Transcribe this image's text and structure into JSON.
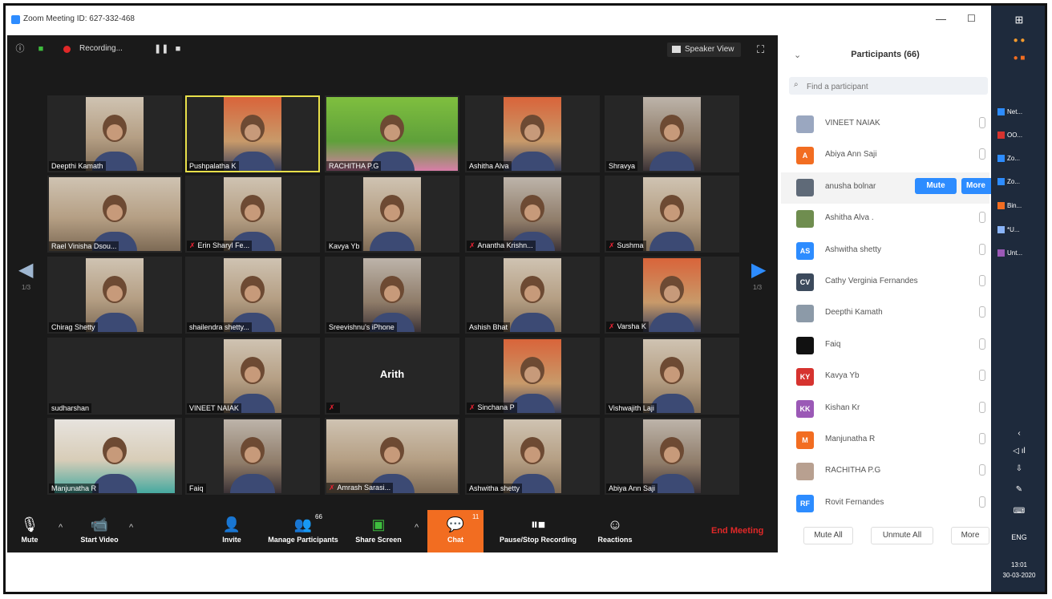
{
  "window": {
    "title": "Zoom Meeting ID: 627-332-468",
    "minimize": "—",
    "maximize": "☐"
  },
  "topbar": {
    "recording": "Recording...",
    "speaker_view": "Speaker View"
  },
  "gallery": {
    "page_left": "1/3",
    "page_right": "1/3",
    "rows": [
      [
        {
          "name": "Deepthi Kamath",
          "muted": false
        },
        {
          "name": "Pushpalatha K",
          "muted": false,
          "active": true
        },
        {
          "name": "RACHITHA P.G",
          "muted": false
        },
        {
          "name": "Ashitha Alva",
          "muted": false
        },
        {
          "name": "Shravya",
          "muted": false
        }
      ],
      [
        {
          "name": "Rael Vinisha Dsou...",
          "muted": false
        },
        {
          "name": "Erin Sharyl Fe...",
          "muted": true
        },
        {
          "name": "Kavya Yb",
          "muted": false
        },
        {
          "name": "Anantha Krishn...",
          "muted": true
        },
        {
          "name": "Sushma",
          "muted": true
        }
      ],
      [
        {
          "name": "Chirag Shetty",
          "muted": false
        },
        {
          "name": "shailendra shetty...",
          "muted": false
        },
        {
          "name": "Sreevishnu's iPhone",
          "muted": false
        },
        {
          "name": "Ashish Bhat",
          "muted": false
        },
        {
          "name": "Varsha K",
          "muted": true
        }
      ],
      [
        {
          "name": "sudharshan",
          "muted": false
        },
        {
          "name": "VINEET NAIAK",
          "muted": false
        },
        {
          "name": "",
          "muted": true,
          "label": "Arith"
        },
        {
          "name": "Sinchana P",
          "muted": true
        },
        {
          "name": "Vishwajith Laji",
          "muted": false
        }
      ],
      [
        {
          "name": "Manjunatha R",
          "muted": false
        },
        {
          "name": "Faiq",
          "muted": false
        },
        {
          "name": "Amrash Sarasi...",
          "muted": true
        },
        {
          "name": "Ashwitha shetty",
          "muted": false
        },
        {
          "name": "Abiya Ann Saji",
          "muted": false
        }
      ]
    ]
  },
  "toolbar": {
    "mute": "Mute",
    "start_video": "Start Video",
    "invite": "Invite",
    "manage_participants": "Manage Participants",
    "participants_count": "66",
    "share_screen": "Share Screen",
    "chat": "Chat",
    "chat_badge": "11",
    "pause_stop_recording": "Pause/Stop Recording",
    "reactions": "Reactions",
    "end_meeting": "End Meeting"
  },
  "panel": {
    "title": "Participants (66)",
    "search_placeholder": "Find a participant",
    "mute_btn": "Mute",
    "more_btn": "More",
    "mute_all": "Mute All",
    "unmute_all": "Unmute All",
    "more": "More",
    "participants": [
      {
        "name": "VINEET NAIAK",
        "initials": "",
        "color": "#9aa7c0"
      },
      {
        "name": "Abiya Ann Saji",
        "initials": "A",
        "color": "#f26d21"
      },
      {
        "name": "anusha bolnar",
        "initials": "",
        "color": "#5f6a78",
        "hover": true
      },
      {
        "name": "Ashitha Alva .",
        "initials": "",
        "color": "#6f8d4f"
      },
      {
        "name": "Ashwitha shetty",
        "initials": "AS",
        "color": "#2d8cff"
      },
      {
        "name": "Cathy Verginia Fernandes",
        "initials": "CV",
        "color": "#3c4a5c"
      },
      {
        "name": "Deepthi Kamath",
        "initials": "",
        "color": "#8c9aa8"
      },
      {
        "name": "Faiq",
        "initials": "",
        "color": "#111111"
      },
      {
        "name": "Kavya Yb",
        "initials": "KY",
        "color": "#d6332f"
      },
      {
        "name": "Kishan Kr",
        "initials": "KK",
        "color": "#9b59b6"
      },
      {
        "name": "Manjunatha R",
        "initials": "M",
        "color": "#f26d21"
      },
      {
        "name": "RACHITHA P.G",
        "initials": "",
        "color": "#b8a090"
      },
      {
        "name": "Rovit Fernandes",
        "initials": "RF",
        "color": "#2d8cff"
      }
    ]
  },
  "taskbar": {
    "items": [
      "Net...",
      "OO...",
      "Zo...",
      "Zo...",
      "Bin...",
      "*U...",
      "Unt..."
    ],
    "lang": "ENG",
    "time": "13:01",
    "date": "30-03-2020"
  }
}
